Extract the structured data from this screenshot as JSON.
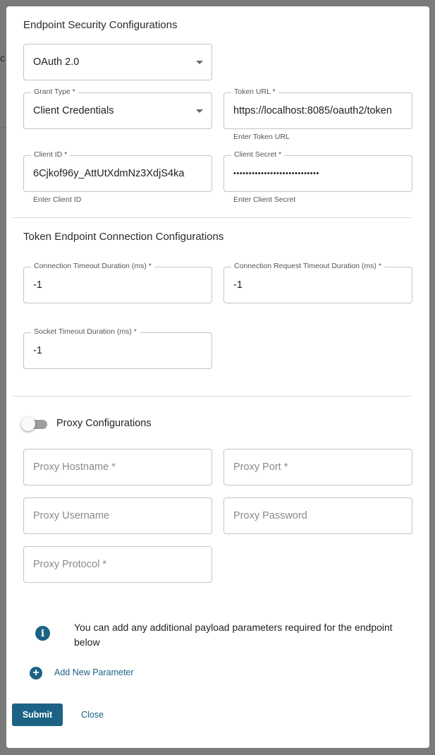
{
  "background": {
    "partial_char": "c"
  },
  "dialog": {
    "title": "Endpoint Security Configurations",
    "security_type": {
      "value": "OAuth 2.0"
    },
    "grant_type": {
      "label": "Grant Type *",
      "value": "Client Credentials"
    },
    "token_url": {
      "label": "Token URL *",
      "value": "https://localhost:8085/oauth2/token",
      "helper": "Enter Token URL"
    },
    "client_id": {
      "label": "Client ID *",
      "value": "6Cjkof96y_AttUtXdmNz3XdjS4ka",
      "helper": "Enter Client ID"
    },
    "client_secret": {
      "label": "Client Secret *",
      "value": "••••••••••••••••••••••••••••",
      "helper": "Enter Client Secret"
    },
    "token_endpoint_section": {
      "title": "Token Endpoint Connection Configurations",
      "connection_timeout": {
        "label": "Connection Timeout Duration (ms) *",
        "value": "-1"
      },
      "connection_request_timeout": {
        "label": "Connection Request Timeout Duration (ms) *",
        "value": "-1"
      },
      "socket_timeout": {
        "label": "Socket Timeout Duration (ms) *",
        "value": "-1"
      }
    },
    "proxy": {
      "toggle_label": "Proxy Configurations",
      "enabled": false,
      "hostname": {
        "placeholder": "Proxy Hostname *"
      },
      "port": {
        "placeholder": "Proxy Port *"
      },
      "username": {
        "placeholder": "Proxy Username"
      },
      "password": {
        "placeholder": "Proxy Password"
      },
      "protocol": {
        "placeholder": "Proxy Protocol *"
      }
    },
    "info": {
      "icon": "info-icon",
      "text": "You can add any additional payload parameters required for the endpoint below"
    },
    "add_parameter": {
      "icon": "plus-circle-icon",
      "label": "Add New Parameter"
    },
    "actions": {
      "submit": "Submit",
      "close": "Close"
    }
  },
  "colors": {
    "accent": "#1b6284",
    "overlay": "#7a7a7a"
  }
}
